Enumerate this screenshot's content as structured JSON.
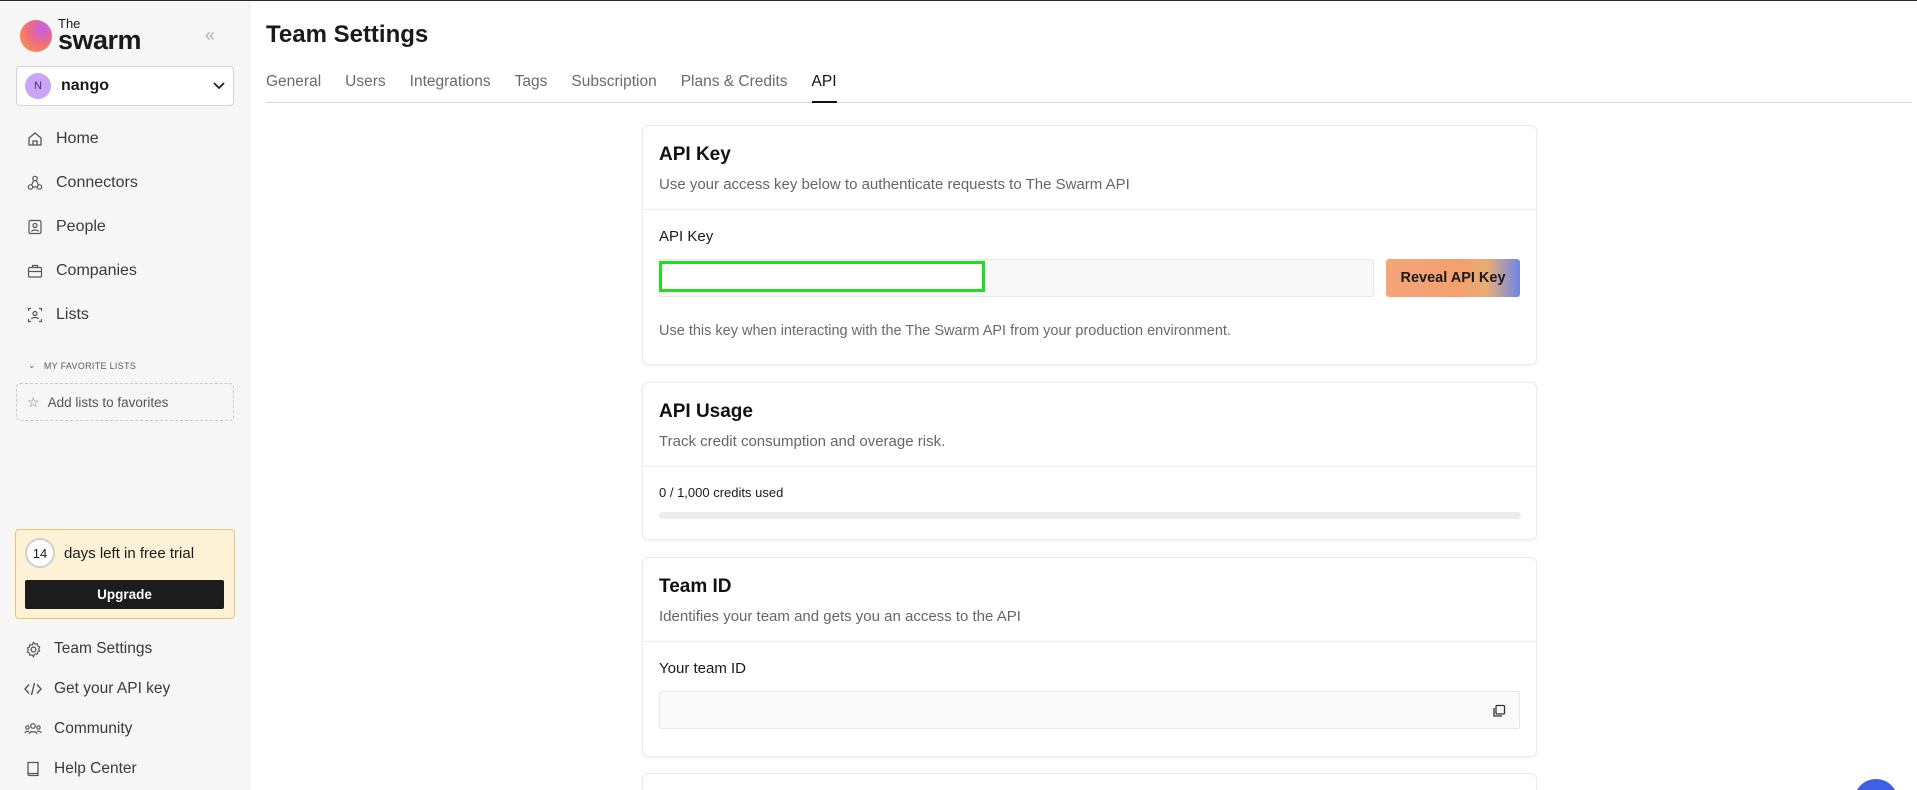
{
  "brand": {
    "small": "The",
    "big": "swarm"
  },
  "sidebar": {
    "team": {
      "initial": "N",
      "name": "nango"
    },
    "nav": [
      {
        "label": "Home",
        "icon": "home-icon"
      },
      {
        "label": "Connectors",
        "icon": "connectors-icon"
      },
      {
        "label": "People",
        "icon": "people-icon"
      },
      {
        "label": "Companies",
        "icon": "briefcase-icon"
      },
      {
        "label": "Lists",
        "icon": "lists-icon"
      }
    ],
    "favorites": {
      "header": "MY FAVORITE LISTS",
      "add_label": "Add lists to favorites"
    },
    "trial": {
      "days": "14",
      "text": "days left in free trial",
      "upgrade_label": "Upgrade"
    },
    "bottom_nav": [
      {
        "label": "Team Settings",
        "icon": "gear-icon"
      },
      {
        "label": "Get your API key",
        "icon": "code-icon"
      },
      {
        "label": "Community",
        "icon": "community-icon"
      },
      {
        "label": "Help Center",
        "icon": "book-icon"
      }
    ]
  },
  "main": {
    "title": "Team Settings",
    "tabs": [
      "General",
      "Users",
      "Integrations",
      "Tags",
      "Subscription",
      "Plans & Credits",
      "API"
    ],
    "active_tab": "API",
    "api_key_card": {
      "title": "API Key",
      "subtitle": "Use your access key below to authenticate requests to The Swarm API",
      "field_label": "API Key",
      "value": "",
      "reveal_label": "Reveal API Key",
      "help": "Use this key when interacting with the The Swarm API from your production environment."
    },
    "usage_card": {
      "title": "API Usage",
      "subtitle": "Track credit consumption and overage risk.",
      "usage_text": "0 / 1,000 credits used",
      "used": 0,
      "total": 1000
    },
    "team_id_card": {
      "title": "Team ID",
      "subtitle": "Identifies your team and gets you an access to the API",
      "field_label": "Your team ID",
      "value": ""
    }
  }
}
